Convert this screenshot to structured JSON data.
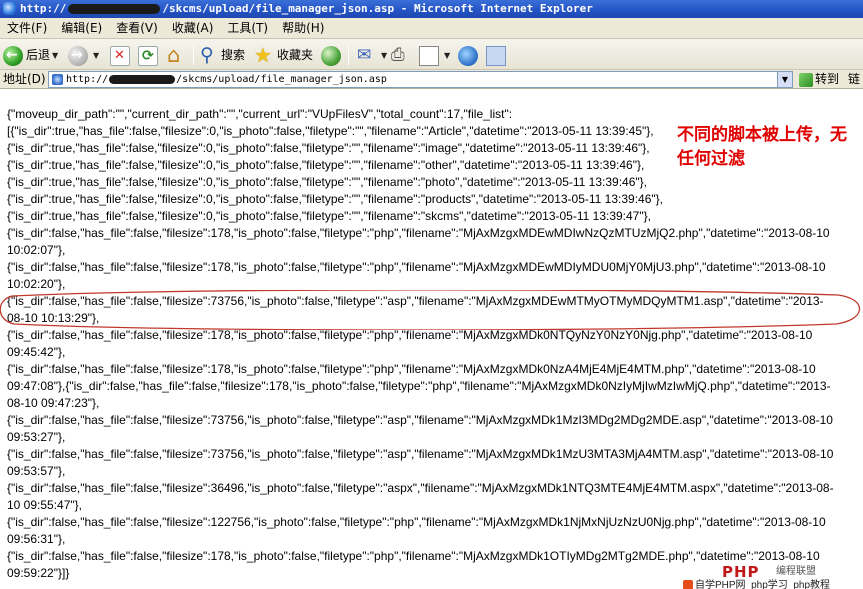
{
  "window": {
    "title_prefix": "http://",
    "title_suffix": "/skcms/upload/file_manager_json.asp - Microsoft Internet Explorer"
  },
  "menu": [
    "文件(F)",
    "编辑(E)",
    "查看(V)",
    "收藏(A)",
    "工具(T)",
    "帮助(H)"
  ],
  "toolbar": {
    "back_label": "后退",
    "search_label": "搜索",
    "favorites_label": "收藏夹"
  },
  "address": {
    "label": "地址(D)",
    "url_prefix": "http://",
    "url_suffix": "/skcms/upload/file_manager_json.asp",
    "go_label": "转到",
    "links_label": "链"
  },
  "content": {
    "lines": [
      "{\"moveup_dir_path\":\"\",\"current_dir_path\":\"\",\"current_url\":\"VUpFilesV\",\"total_count\":17,\"file_list\":",
      "[{\"is_dir\":true,\"has_file\":false,\"filesize\":0,\"is_photo\":false,\"filetype\":\"\",\"filename\":\"Article\",\"datetime\":\"2013-05-11 13:39:45\"},",
      "{\"is_dir\":true,\"has_file\":false,\"filesize\":0,\"is_photo\":false,\"filetype\":\"\",\"filename\":\"image\",\"datetime\":\"2013-05-11 13:39:46\"},",
      "{\"is_dir\":true,\"has_file\":false,\"filesize\":0,\"is_photo\":false,\"filetype\":\"\",\"filename\":\"other\",\"datetime\":\"2013-05-11 13:39:46\"},",
      "{\"is_dir\":true,\"has_file\":false,\"filesize\":0,\"is_photo\":false,\"filetype\":\"\",\"filename\":\"photo\",\"datetime\":\"2013-05-11 13:39:46\"},",
      "{\"is_dir\":true,\"has_file\":false,\"filesize\":0,\"is_photo\":false,\"filetype\":\"\",\"filename\":\"products\",\"datetime\":\"2013-05-11 13:39:46\"},",
      "{\"is_dir\":true,\"has_file\":false,\"filesize\":0,\"is_photo\":false,\"filetype\":\"\",\"filename\":\"skcms\",\"datetime\":\"2013-05-11 13:39:47\"},",
      "{\"is_dir\":false,\"has_file\":false,\"filesize\":178,\"is_photo\":false,\"filetype\":\"php\",\"filename\":\"MjAxMzgxMDEwMDIwNzQzMTUzMjQ2.php\",\"datetime\":\"2013-08-10",
      "10:02:07\"},",
      "{\"is_dir\":false,\"has_file\":false,\"filesize\":178,\"is_photo\":false,\"filetype\":\"php\",\"filename\":\"MjAxMzgxMDEwMDIyMDU0MjY0MjU3.php\",\"datetime\":\"2013-08-10",
      "10:02:20\"},",
      "{\"is_dir\":false,\"has_file\":false,\"filesize\":73756,\"is_photo\":false,\"filetype\":\"asp\",\"filename\":\"MjAxMzgxMDEwMTMyOTMyMDQyMTM1.asp\",\"datetime\":\"2013-",
      "08-10 10:13:29\"},",
      "{\"is_dir\":false,\"has_file\":false,\"filesize\":178,\"is_photo\":false,\"filetype\":\"php\",\"filename\":\"MjAxMzgxMDk0NTQyNzY0NzY0Njg.php\",\"datetime\":\"2013-08-10",
      "09:45:42\"},",
      "{\"is_dir\":false,\"has_file\":false,\"filesize\":178,\"is_photo\":false,\"filetype\":\"php\",\"filename\":\"MjAxMzgxMDk0NzA4MjE4MjE4MTM.php\",\"datetime\":\"2013-08-10",
      "09:47:08\"},{\"is_dir\":false,\"has_file\":false,\"filesize\":178,\"is_photo\":false,\"filetype\":\"php\",\"filename\":\"MjAxMzgxMDk0NzIyMjIwMzIwMjQ.php\",\"datetime\":\"2013-",
      "08-10 09:47:23\"},",
      "{\"is_dir\":false,\"has_file\":false,\"filesize\":73756,\"is_photo\":false,\"filetype\":\"asp\",\"filename\":\"MjAxMzgxMDk1MzI3MDg2MDg2MDE.asp\",\"datetime\":\"2013-08-10",
      "09:53:27\"},",
      "{\"is_dir\":false,\"has_file\":false,\"filesize\":73756,\"is_photo\":false,\"filetype\":\"asp\",\"filename\":\"MjAxMzgxMDk1MzU3MTA3MjA4MTM.asp\",\"datetime\":\"2013-08-10",
      "09:53:57\"},",
      "{\"is_dir\":false,\"has_file\":false,\"filesize\":36496,\"is_photo\":false,\"filetype\":\"aspx\",\"filename\":\"MjAxMzgxMDk1NTQ3MTE4MjE4MTM.aspx\",\"datetime\":\"2013-08-",
      "10 09:55:47\"},",
      "{\"is_dir\":false,\"has_file\":false,\"filesize\":122756,\"is_photo\":false,\"filetype\":\"php\",\"filename\":\"MjAxMzgxMDk1NjMxNjUzNzU0Njg.php\",\"datetime\":\"2013-08-10",
      "09:56:31\"},",
      "{\"is_dir\":false,\"has_file\":false,\"filesize\":178,\"is_photo\":false,\"filetype\":\"php\",\"filename\":\"MjAxMzgxMDk1OTIyMDg2MTg2MDE.php\",\"datetime\":\"2013-08-10",
      "09:59:22\"}]}"
    ]
  },
  "annotation": {
    "text": "不同的脚本被上传，无任何过滤",
    "color": "#e00000"
  },
  "watermark": {
    "logo": "PHP",
    "badge": "编程联盟",
    "line": "自学PHP网_php学习_php教程"
  },
  "colors": {
    "titlebar": "#2453c4",
    "chrome": "#ece9d8",
    "highlight_circle": "#c0392b"
  }
}
